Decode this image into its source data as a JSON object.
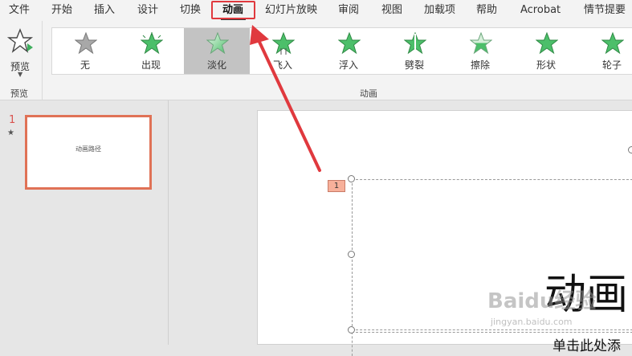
{
  "menu": {
    "tabs": [
      {
        "id": "file",
        "label": "文件"
      },
      {
        "id": "home",
        "label": "开始"
      },
      {
        "id": "insert",
        "label": "插入"
      },
      {
        "id": "design",
        "label": "设计"
      },
      {
        "id": "transitions",
        "label": "切换"
      },
      {
        "id": "animations",
        "label": "动画"
      },
      {
        "id": "slideshow",
        "label": "幻灯片放映"
      },
      {
        "id": "review",
        "label": "审阅"
      },
      {
        "id": "view",
        "label": "视图"
      },
      {
        "id": "addins",
        "label": "加载项"
      },
      {
        "id": "help",
        "label": "帮助"
      },
      {
        "id": "acrobat",
        "label": "Acrobat"
      },
      {
        "id": "storyboard",
        "label": "情节提要"
      }
    ],
    "active": "animations"
  },
  "ribbon": {
    "preview": {
      "label": "预览",
      "group_label": "预览"
    },
    "animations_group_label": "动画",
    "gallery": [
      {
        "label": "无",
        "icon": "star-gray-icon"
      },
      {
        "label": "出现",
        "icon": "star-appear-icon"
      },
      {
        "label": "淡化",
        "icon": "star-fade-icon",
        "selected": true
      },
      {
        "label": "飞入",
        "icon": "star-flyin-icon"
      },
      {
        "label": "浮入",
        "icon": "star-floatin-icon"
      },
      {
        "label": "劈裂",
        "icon": "star-split-icon"
      },
      {
        "label": "擦除",
        "icon": "star-wipe-icon"
      },
      {
        "label": "形状",
        "icon": "star-shape-icon"
      },
      {
        "label": "轮子",
        "icon": "star-wheel-icon"
      }
    ]
  },
  "slides_panel": {
    "slides": [
      {
        "number": "1",
        "has_animation_icon": "star-icon",
        "thumb_text": "动画路径"
      }
    ]
  },
  "canvas": {
    "animation_tag": "1",
    "title_text": "动画",
    "subtitle_text": "单击此处添"
  },
  "watermark": {
    "logo": "Baidu经验",
    "url": "jingyan.baidu.com"
  },
  "colors": {
    "accent_red": "#e0393e",
    "thumb_border": "#e07256",
    "star_green": "#4cbf6a",
    "selected_bg": "#c3c3c3"
  }
}
